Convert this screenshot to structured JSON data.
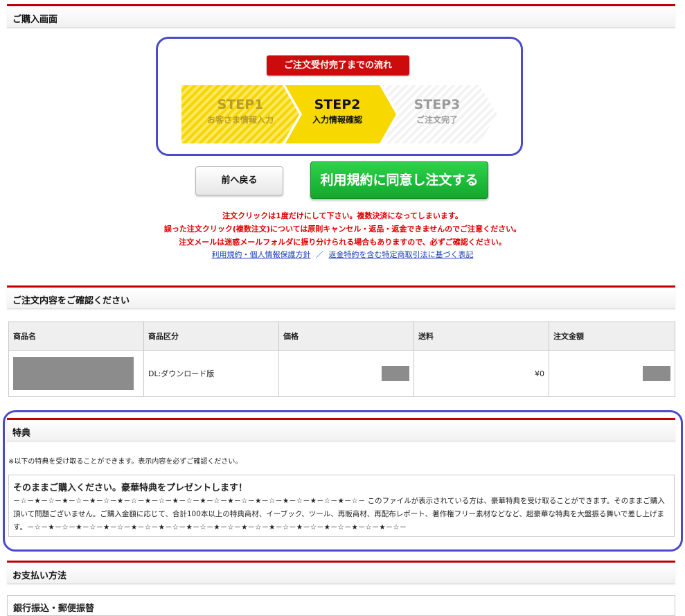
{
  "sections": {
    "purchase": "ご購入画面",
    "confirm": "ご注文内容をご確認ください",
    "bonus": "特典",
    "payment": "お支払い方法"
  },
  "flow": {
    "badge": "ご注文受付完了までの流れ",
    "steps": [
      {
        "title": "STEP1",
        "sub": "お客さま情報入力"
      },
      {
        "title": "STEP2",
        "sub": "入力情報確認"
      },
      {
        "title": "STEP3",
        "sub": "ご注文完了"
      }
    ]
  },
  "buttons": {
    "back": "前へ戻る",
    "order": "利用規約に同意し注文する"
  },
  "notices": [
    "注文クリックは1度だけにして下さい。複数決済になってしまいます。",
    "誤った注文クリック(複数注文)については原則キャンセル・返品・返金できませんのでご注意ください。",
    "注文メールは迷惑メールフォルダに振り分けられる場合もありますので、必ずご確認ください。"
  ],
  "links": {
    "terms": "利用規約・個人情報保護方針",
    "separator": "／",
    "law": "返金特約を含む特定商取引法に基づく表記"
  },
  "table": {
    "headers": [
      "商品名",
      "商品区分",
      "価格",
      "送料",
      "注文金額"
    ],
    "row": {
      "category": "DL:ダウンロード版",
      "shipping": "¥0"
    }
  },
  "bonus": {
    "note": "※以下の特典を受け取ることができます。表示内容を必ずご確認ください。",
    "title": "そのままご購入ください。豪華特典をプレゼントします！",
    "body": "－☆－★－☆－★－☆－★－☆－★－☆－★－☆－★－☆－★－☆－★－☆－★－☆－★－☆－★－☆－★－☆－ このファイルが表示されている方は、豪華特典を受け取ることができます。そのままご購入頂いて問題ございません。ご購入金額に応じて、合計100本以上の特典商材、イーブック、ツール、再販商材、再配布レポート、著作権フリー素材などなど、超豪華な特典を大盤振る舞いで差し上げます。－☆－★－☆－★－☆－★－☆－★－☆－★－☆－★－☆－★－☆－★－☆－★－☆－★－☆－★－☆－★－☆－★－☆－"
  },
  "payment": {
    "method": "銀行振込・郵便振替"
  },
  "colors": {
    "accent_red": "#c00000",
    "step_yellow": "#f6d200",
    "order_green": "#1cbf38",
    "frame_blue": "#4b4bc8"
  }
}
